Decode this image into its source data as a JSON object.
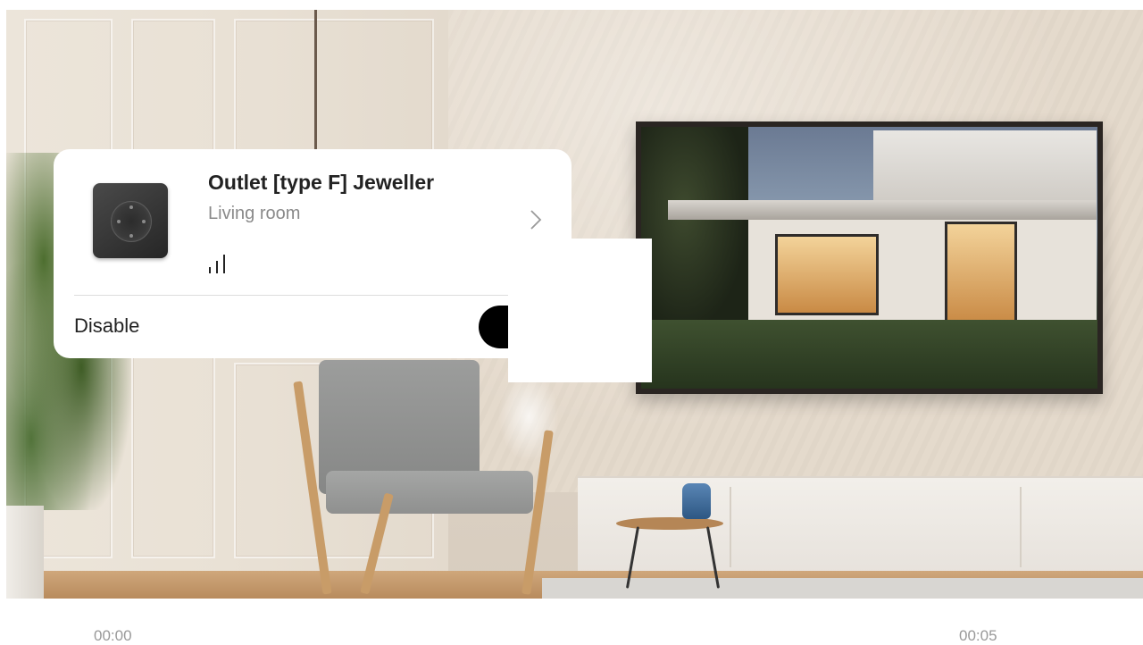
{
  "device": {
    "name": "Outlet [type F] Jeweller",
    "room": "Living room",
    "icon": "outlet-type-f-icon",
    "signal_icon": "signal-strength-icon",
    "chevron_icon": "chevron-right-icon"
  },
  "controls": {
    "disable_label": "Disable",
    "disable_toggle_icon": "toggle-icon"
  },
  "video": {
    "current_time": "00:00",
    "duration": "00:05"
  },
  "colors": {
    "card_background": "#ffffff",
    "title_text": "#222222",
    "secondary_text": "#8a8a8a",
    "toggle": "#000000",
    "timestamp": "#999999"
  }
}
